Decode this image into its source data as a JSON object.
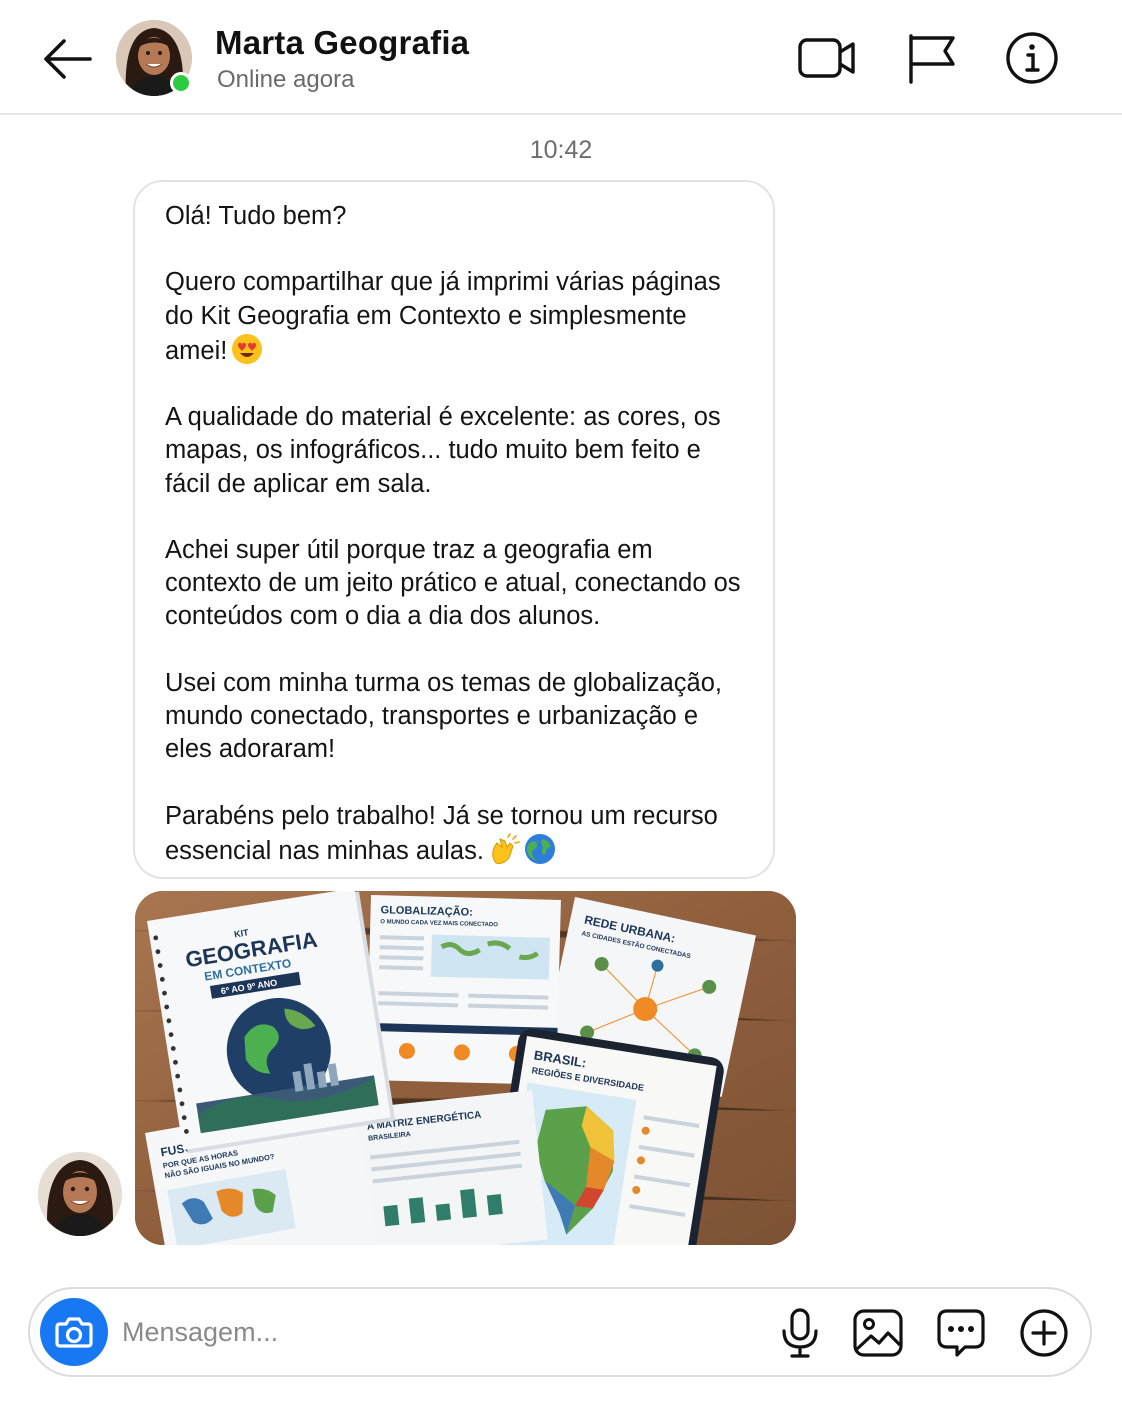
{
  "header": {
    "contact_name": "Marta Geografia",
    "status": "Online agora",
    "icons": [
      "back-arrow-icon",
      "video-camera-icon",
      "flag-icon",
      "info-icon"
    ]
  },
  "chat": {
    "timestamp": "10:42",
    "message_paragraphs": [
      "Olá! Tudo bem?",
      "Quero compartilhar que já imprimi várias páginas do Kit Geografia em Contexto e simplesmente amei!",
      "A qualidade do material é excelente: as cores, os mapas, os infográficos... tudo muito bem feito e fácil de aplicar em sala.",
      "Achei super útil porque traz a geografia em contexto de um jeito prático e atual, conectando os conteúdos com o dia a dia dos alunos.",
      "Usei com minha turma os temas de globalização, mundo conectado, transportes e urbanização e eles adoraram!",
      "Parabéns pelo trabalho! Já se tornou um recurso essencial nas minhas aulas."
    ],
    "emojis": [
      "heart-eyes-emoji",
      "clapping-hands-emoji",
      "globe-emoji"
    ],
    "attachment": {
      "cover_kit": "KIT",
      "cover_title": "GEOGRAFIA",
      "cover_subtitle": "EM CONTEXTO",
      "cover_grades": "6º AO 9º ANO",
      "page_globalizacao": "GLOBALIZAÇÃO:",
      "page_globalizacao_sub": "O MUNDO CADA VEZ MAIS CONECTADO",
      "page_rede_urbana": "REDE URBANA:",
      "page_rede_urbana_sub": "AS CIDADES ESTÃO CONECTADAS",
      "page_brasil": "BRASIL:",
      "page_brasil_sub": "REGIÕES E DIVERSIDADE",
      "page_matriz": "A MATRIZ ENERGÉTICA",
      "page_matriz_sub": "BRASILEIRA",
      "page_fusos": "FUSOS HORÁRIOS:",
      "page_fusos_sub1": "POR QUE AS HORAS",
      "page_fusos_sub2": "NÃO SÃO IGUAIS NO MUNDO?"
    }
  },
  "composer": {
    "placeholder": "Mensagem...",
    "icons": [
      "camera-icon",
      "microphone-icon",
      "image-icon",
      "chat-bubble-icon",
      "plus-circle-icon"
    ]
  },
  "colors": {
    "accent_blue": "#1877f2",
    "online_green": "#2ecc40",
    "cover_navy": "#1d3557"
  }
}
